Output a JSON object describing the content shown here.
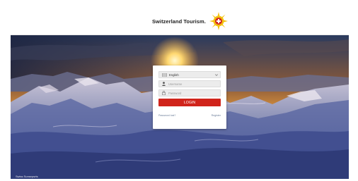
{
  "header": {
    "brand_name": "Switzerland Tourism.",
    "logo_icon": "swiss-sun-flower-logo"
  },
  "login": {
    "language": {
      "value": "English",
      "icon": "flag-icon"
    },
    "username": {
      "placeholder": "Username",
      "icon": "user-icon"
    },
    "password": {
      "placeholder": "Password",
      "icon": "lock-icon"
    },
    "login_label": "LOGIN",
    "forgot_label": "Password lost?",
    "register_label": "Register"
  },
  "footer": {
    "text": "Swiss Sunsepsrts"
  },
  "colors": {
    "accent": "#d0241b",
    "logo_yellow": "#f3c311",
    "logo_red": "#d52b1e"
  }
}
